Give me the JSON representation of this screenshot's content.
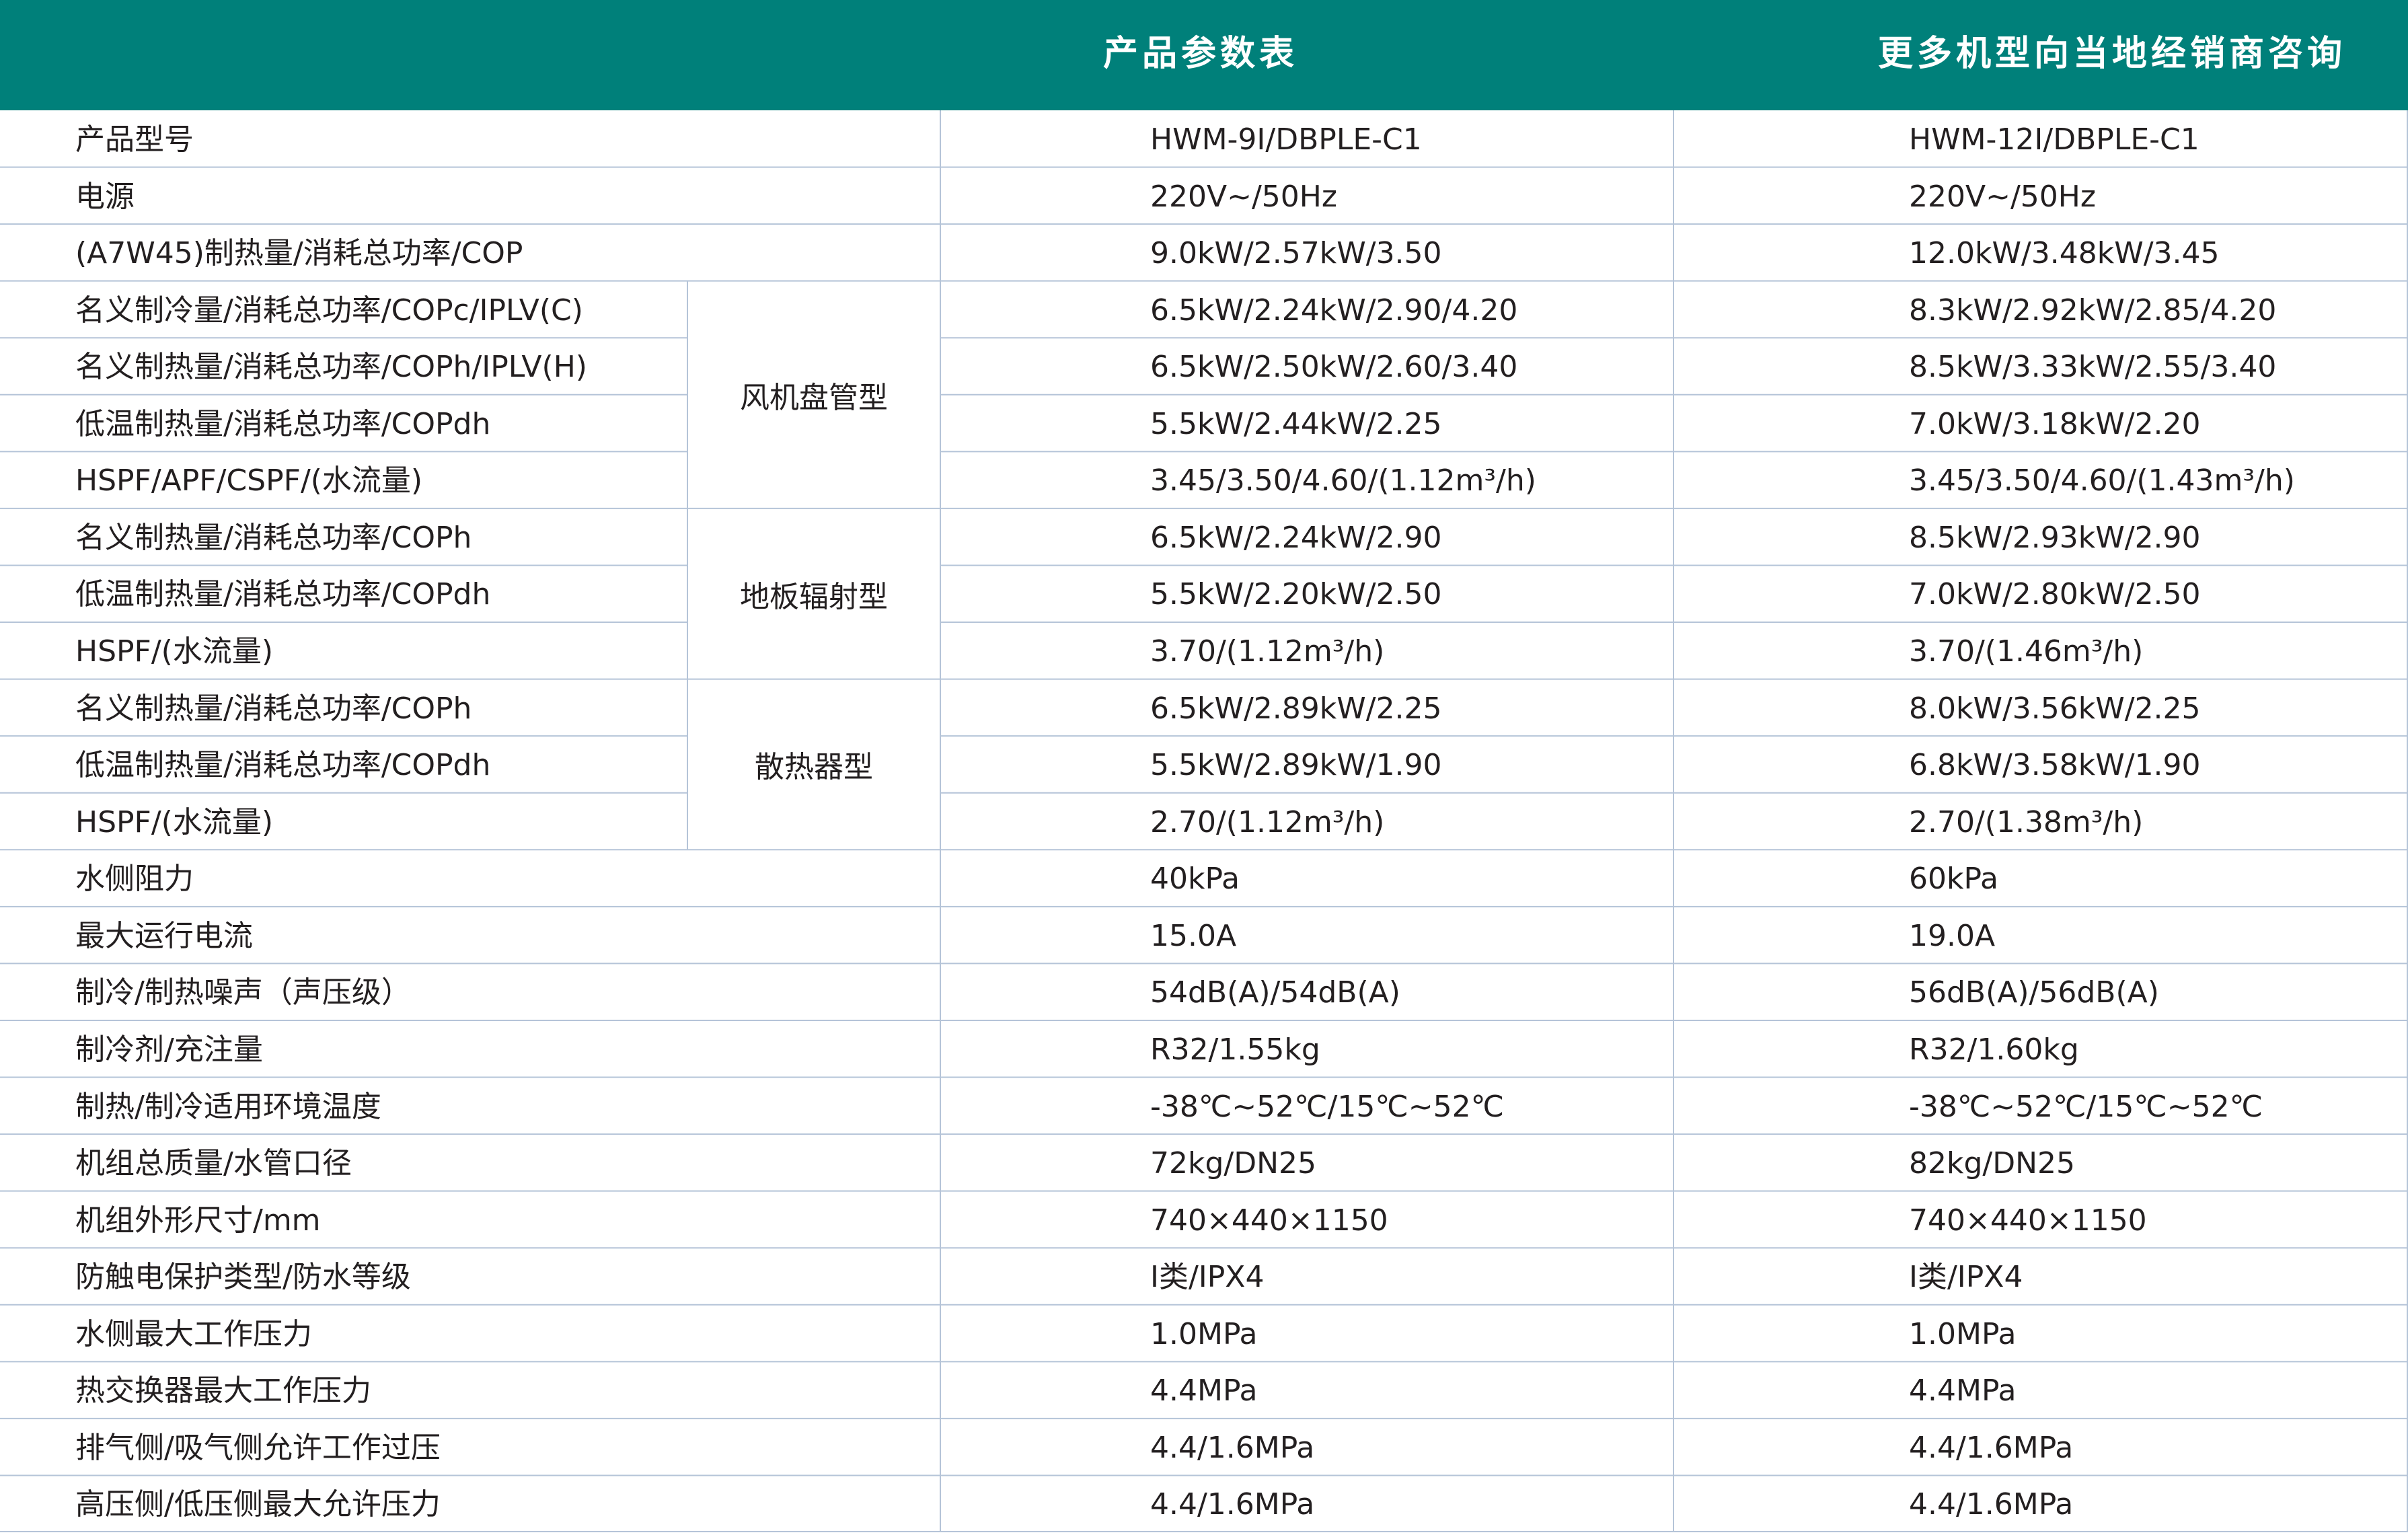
{
  "header": {
    "title": "产品参数表",
    "note": "更多机型向当地经销商咨询"
  },
  "colors": {
    "header_bg": "#00807a",
    "grid_line": "#b5c4d8",
    "text": "#231f20"
  },
  "rows": [
    {
      "label": "产品型号",
      "c1": "HWM-9Ⅰ/DBPLE-C1",
      "c2": "HWM-12Ⅰ/DBPLE-C1"
    },
    {
      "label": "电源",
      "c1": "220V~/50Hz",
      "c2": "220V~/50Hz"
    },
    {
      "label": "(A7W45)制热量/消耗总功率/COP",
      "c1": "9.0kW/2.57kW/3.50",
      "c2": "12.0kW/3.48kW/3.45"
    },
    {
      "label": "名义制冷量/消耗总功率/COPc/IPLV(C)",
      "c1": "6.5kW/2.24kW/2.90/4.20",
      "c2": "8.3kW/2.92kW/2.85/4.20"
    },
    {
      "label": "名义制热量/消耗总功率/COPh/IPLV(H)",
      "c1": "6.5kW/2.50kW/2.60/3.40",
      "c2": "8.5kW/3.33kW/2.55/3.40"
    },
    {
      "label": "低温制热量/消耗总功率/COPdh",
      "c1": "5.5kW/2.44kW/2.25",
      "c2": "7.0kW/3.18kW/2.20"
    },
    {
      "label": "HSPF/APF/CSPF/(水流量)",
      "c1": "3.45/3.50/4.60/(1.12m³/h)",
      "c2": "3.45/3.50/4.60/(1.43m³/h)"
    },
    {
      "label": "名义制热量/消耗总功率/COPh",
      "c1": "6.5kW/2.24kW/2.90",
      "c2": "8.5kW/2.93kW/2.90"
    },
    {
      "label": "低温制热量/消耗总功率/COPdh",
      "c1": "5.5kW/2.20kW/2.50",
      "c2": "7.0kW/2.80kW/2.50"
    },
    {
      "label": "HSPF/(水流量)",
      "c1": "3.70/(1.12m³/h)",
      "c2": "3.70/(1.46m³/h)"
    },
    {
      "label": "名义制热量/消耗总功率/COPh",
      "c1": "6.5kW/2.89kW/2.25",
      "c2": "8.0kW/3.56kW/2.25"
    },
    {
      "label": "低温制热量/消耗总功率/COPdh",
      "c1": "5.5kW/2.89kW/1.90",
      "c2": "6.8kW/3.58kW/1.90"
    },
    {
      "label": "HSPF/(水流量)",
      "c1": "2.70/(1.12m³/h)",
      "c2": "2.70/(1.38m³/h)"
    },
    {
      "label": "水侧阻力",
      "c1": "40kPa",
      "c2": "60kPa"
    },
    {
      "label": "最大运行电流",
      "c1": "15.0A",
      "c2": "19.0A"
    },
    {
      "label": "制冷/制热噪声（声压级）",
      "c1": "54dB(A)/54dB(A)",
      "c2": "56dB(A)/56dB(A)"
    },
    {
      "label": "制冷剂/充注量",
      "c1": "R32/1.55kg",
      "c2": "R32/1.60kg"
    },
    {
      "label": "制热/制冷适用环境温度",
      "c1": "-38℃~52℃/15℃~52℃",
      "c2": "-38℃~52℃/15℃~52℃"
    },
    {
      "label": "机组总质量/水管口径",
      "c1": "72kg/DN25",
      "c2": "82kg/DN25"
    },
    {
      "label": "机组外形尺寸/mm",
      "c1": "740×440×1150",
      "c2": "740×440×1150"
    },
    {
      "label": "防触电保护类型/防水等级",
      "c1": "Ⅰ类/IPX4",
      "c2": "Ⅰ类/IPX4"
    },
    {
      "label": "水侧最大工作压力",
      "c1": "1.0MPa",
      "c2": "1.0MPa"
    },
    {
      "label": "热交换器最大工作压力",
      "c1": "4.4MPa",
      "c2": "4.4MPa"
    },
    {
      "label": "排气侧/吸气侧允许工作过压",
      "c1": "4.4/1.6MPa",
      "c2": "4.4/1.6MPa"
    },
    {
      "label": "高压侧/低压侧最大允许压力",
      "c1": "4.4/1.6MPa",
      "c2": "4.4/1.6MPa"
    }
  ],
  "groups": [
    {
      "label": "风机盘管型",
      "start": 3,
      "end": 6
    },
    {
      "label": "地板辐射型",
      "start": 7,
      "end": 9
    },
    {
      "label": "散热器型",
      "start": 10,
      "end": 12
    }
  ]
}
